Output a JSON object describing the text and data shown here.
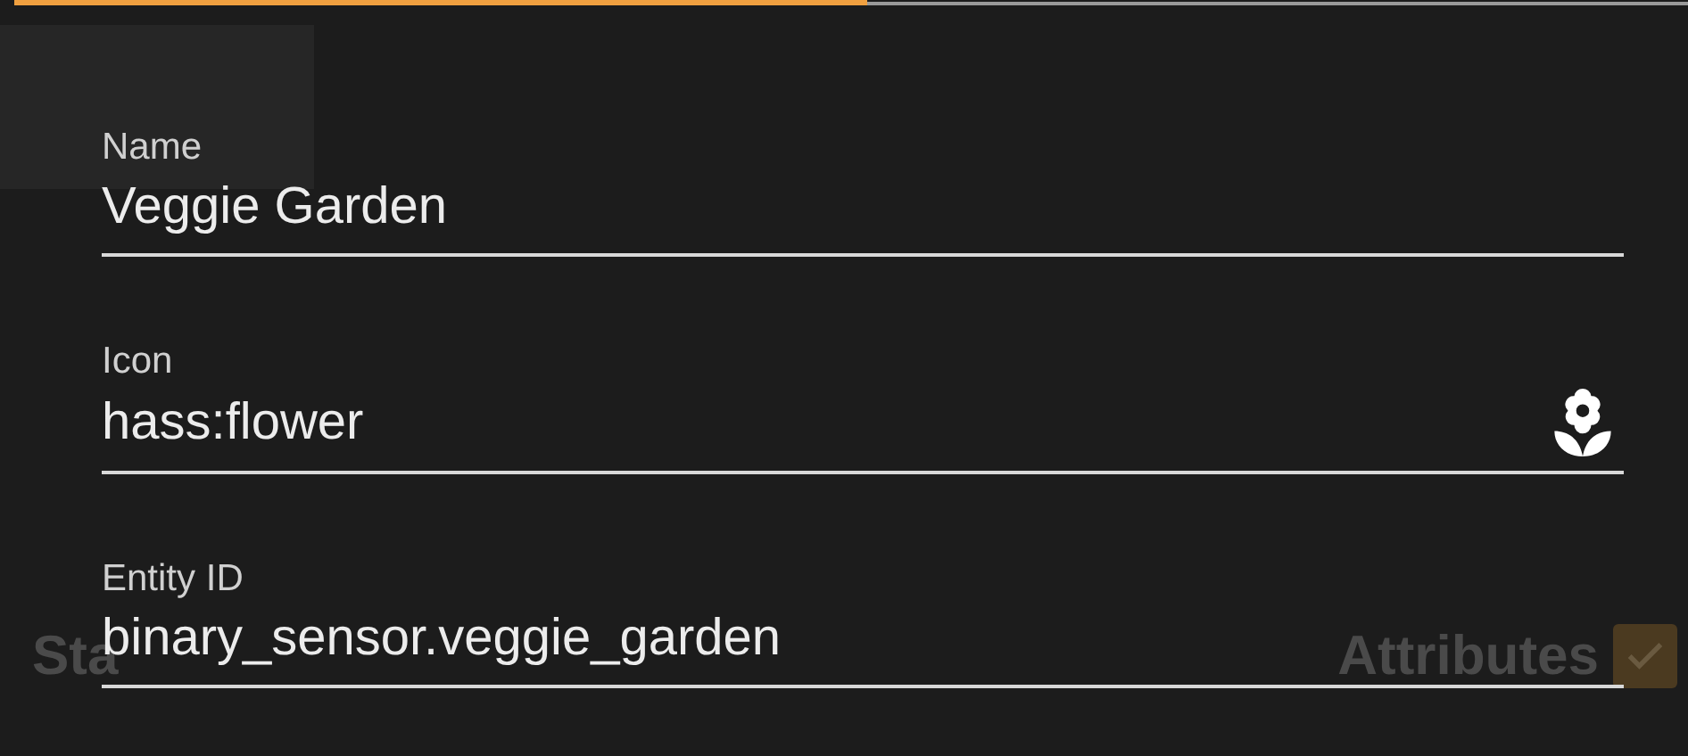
{
  "top_indicator": {
    "level": 0.51
  },
  "background": {
    "left_heading": "Sta",
    "right_heading": "Attributes",
    "attributes_checked": true
  },
  "fields": [
    {
      "label": "Name",
      "value": "Veggie Garden",
      "icon": false
    },
    {
      "label": "Icon",
      "value": "hass:flower",
      "icon": true
    },
    {
      "label": "Entity ID",
      "value": "binary_sensor.veggie_garden",
      "icon": false
    }
  ]
}
